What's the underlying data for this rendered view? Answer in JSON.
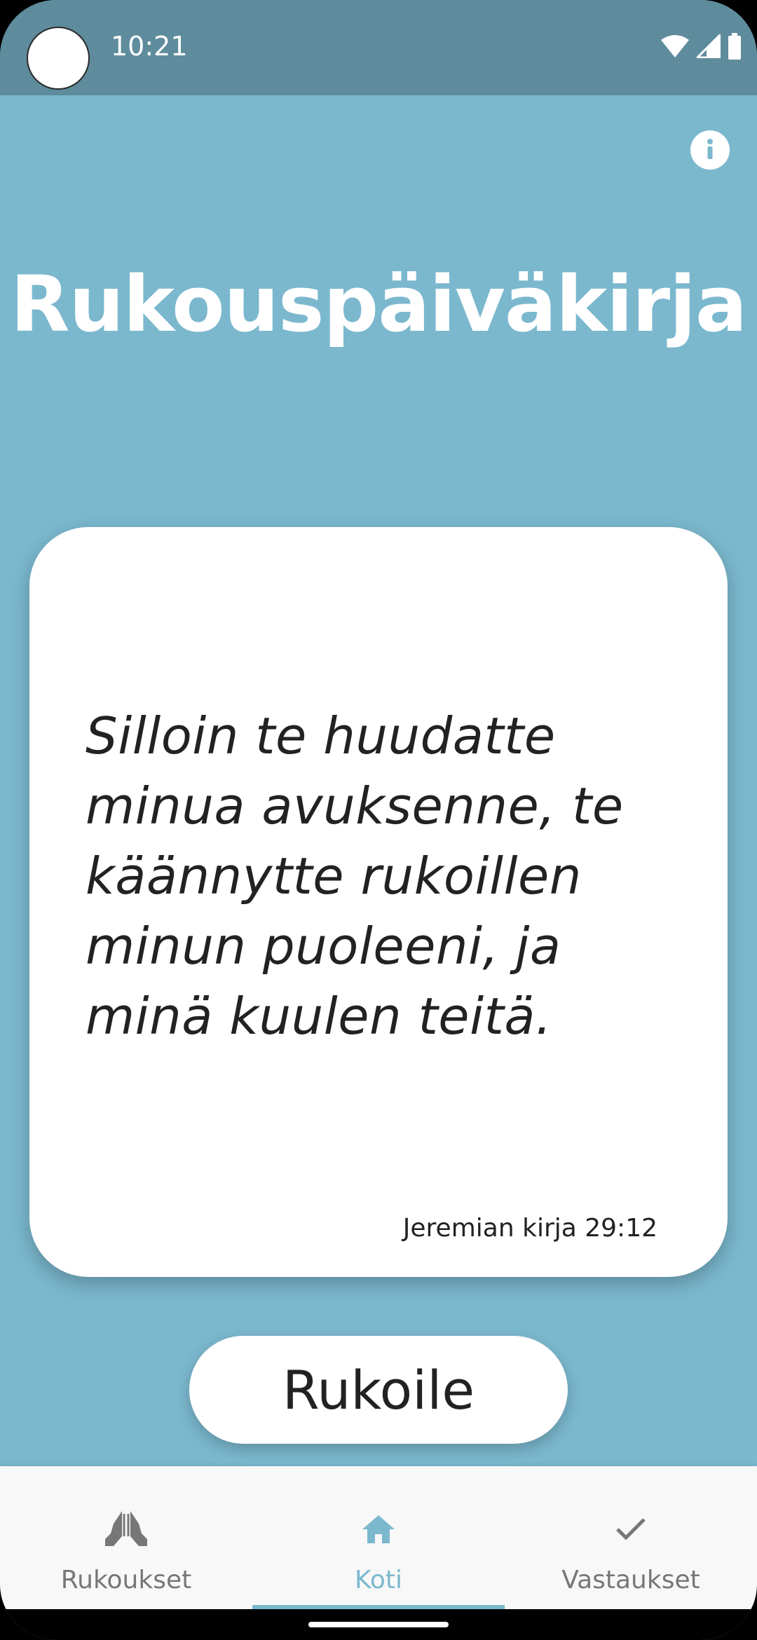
{
  "status_bar": {
    "time": "10:21",
    "icons": [
      "wifi-icon",
      "signal-icon",
      "battery-icon"
    ]
  },
  "header": {
    "info_icon": "info-icon",
    "title": "Rukouspäiväkirja"
  },
  "verse": {
    "text": "Silloin te huudatte minua avuksenne, te käännytte rukoillen minun puoleeni, ja minä kuulen teitä.",
    "reference": "Jeremian kirja 29:12"
  },
  "pray_button": {
    "label": "Rukoile"
  },
  "bottom_nav": {
    "items": [
      {
        "label": "Rukoukset",
        "icon": "praying-hands-icon",
        "active": false
      },
      {
        "label": "Koti",
        "icon": "home-icon",
        "active": true
      },
      {
        "label": "Vastaukset",
        "icon": "check-icon",
        "active": false
      }
    ]
  },
  "colors": {
    "background": "#7bb8ce",
    "status_bar": "#5e8c9d",
    "accent": "#7bb8ce",
    "card": "#ffffff",
    "text": "#222222",
    "nav_inactive": "#777777"
  }
}
